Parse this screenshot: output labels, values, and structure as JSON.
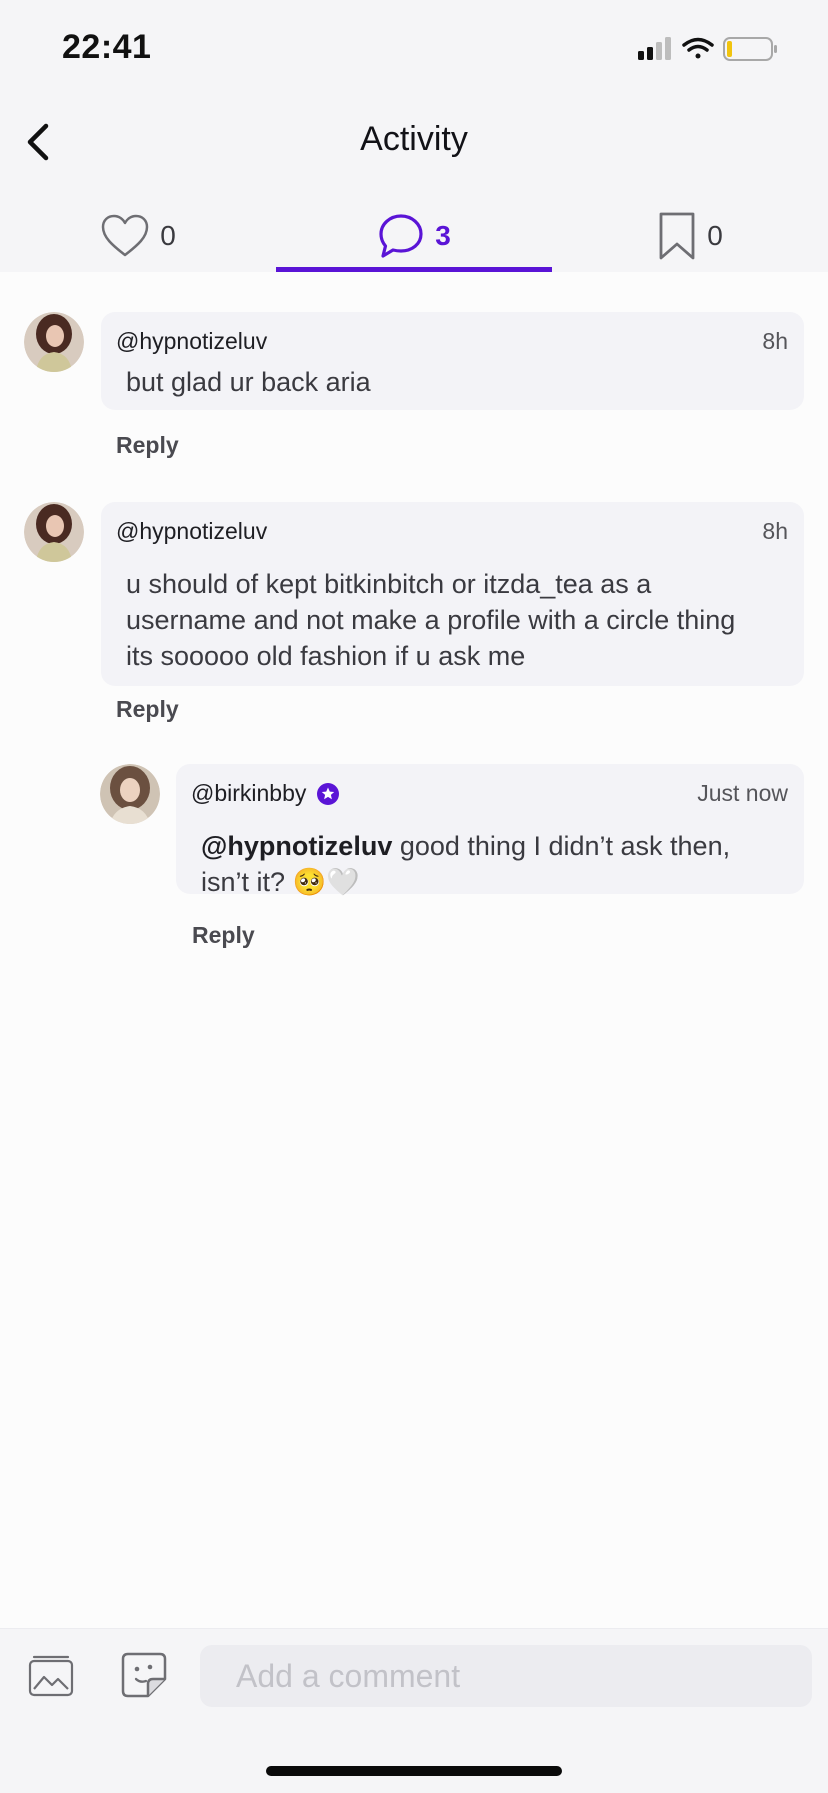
{
  "status": {
    "time": "22:41"
  },
  "header": {
    "title": "Activity",
    "tabs": [
      {
        "icon": "heart-icon",
        "count": "0"
      },
      {
        "icon": "comment-bubble-icon",
        "count": "3"
      },
      {
        "icon": "bookmark-icon",
        "count": "0"
      }
    ]
  },
  "comments": [
    {
      "username": "@hypnotizeluv",
      "time": "8h",
      "text": "but glad ur back aria",
      "reply_label": "Reply"
    },
    {
      "username": "@hypnotizeluv",
      "time": "8h",
      "text": "u should of kept bitkinbitch or itzda_tea as a username and not make a profile with a circle thing its sooooo old fashion if u ask me",
      "reply_label": "Reply"
    },
    {
      "username": "@birkinbby",
      "badge": "verified-star-badge-icon",
      "time": "Just now",
      "mention": "@hypnotizeluv",
      "text": " good thing I didn’t ask then, isn’t it? 🥺🤍",
      "reply_label": "Reply"
    }
  ],
  "composer": {
    "placeholder": "Add a comment"
  },
  "colors": {
    "accent": "#5a14d6",
    "bubble": "#f3f3f7",
    "background": "#fcfcfc"
  }
}
